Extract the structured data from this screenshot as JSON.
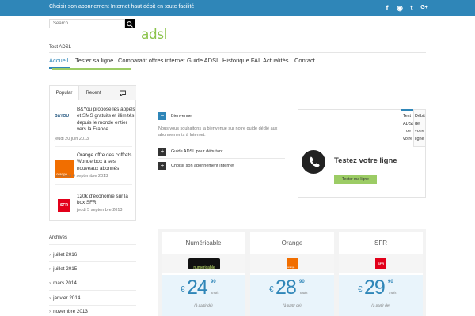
{
  "topbar": {
    "tagline": "Choisir son abonnement Internet haut débit en toute facilité",
    "social": [
      {
        "icon": "facebook-icon",
        "glyph": "f"
      },
      {
        "icon": "rss-icon",
        "glyph": "◉"
      },
      {
        "icon": "twitter-icon",
        "glyph": "t"
      },
      {
        "icon": "google-plus-icon",
        "glyph": "G+"
      }
    ]
  },
  "header": {
    "search_placeholder": "Search ...",
    "logo": "adsl",
    "site_label": "Test ADSL"
  },
  "nav": {
    "items": [
      "Accueil",
      "Tester sa ligne",
      "Comparatif offres internet",
      "Guide ADSL",
      "Historique FAI",
      "Actualités",
      "Contact"
    ],
    "active": "Accueil"
  },
  "sidebar": {
    "tabs": [
      "Popular",
      "Recent",
      "comments-icon"
    ],
    "posts": [
      {
        "thumb": "B&YOU",
        "title": "B&You propose les appels et SMS gratuits et illimités depuis le monde entier vers la France",
        "date": "jeudi 20 juin 2013"
      },
      {
        "thumb": "orange",
        "title": "Orange offre des coffrets Wonderbox à ses nouveaux abonnés",
        "date": "mercredi 4 septembre 2013"
      },
      {
        "thumb": "SFR",
        "title": "120€ d'économie sur la box SFR",
        "date": "jeudi 5 septembre 2013"
      }
    ],
    "archives_title": "Archives",
    "archives": [
      "juillet 2016",
      "juillet 2015",
      "mars 2014",
      "janvier 2014",
      "novembre 2013"
    ]
  },
  "accordion": {
    "items": [
      {
        "title": "Bienvenue",
        "open": true
      },
      {
        "title": "Guide ADSL pour débutant",
        "open": false
      },
      {
        "title": "Choisir son abonnement Internet",
        "open": false
      }
    ],
    "welcome_text": "Nous vous souhaitons la bienvenue sur notre guide dédié aux abonnements à Internet."
  },
  "test_box": {
    "title": "Testez votre ligne",
    "button": "Tester ma ligne",
    "side_tab_lines": [
      "Test",
      "ADSL",
      "de",
      "votre"
    ],
    "side_panel_lines": [
      "Débit",
      "de",
      "votre",
      "ligne"
    ]
  },
  "pricing": {
    "currency": "€",
    "per": "mois",
    "from": "(à partir de)",
    "offers": [
      {
        "name": "Numéricable",
        "logo": "numericable",
        "price": "24",
        "cents": "90"
      },
      {
        "name": "Orange",
        "logo": "orange",
        "price": "28",
        "cents": "90"
      },
      {
        "name": "SFR",
        "logo": "SFR",
        "price": "29",
        "cents": "90"
      }
    ]
  },
  "colors": {
    "brand_blue": "#2f86b8",
    "brand_green": "#8bc34a",
    "orange": "#f16e00",
    "sfr_red": "#e2001a"
  }
}
